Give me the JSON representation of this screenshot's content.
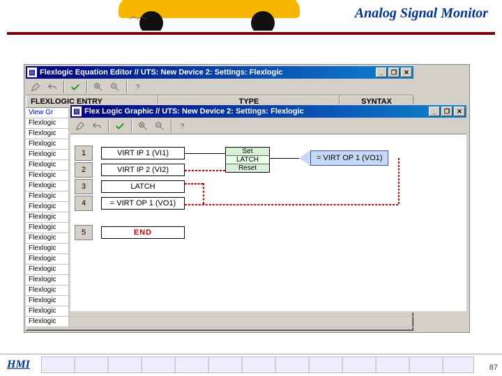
{
  "page": {
    "title": "Analog Signal Monitor",
    "footer_label": "HMI",
    "page_number": "87"
  },
  "editor_window": {
    "title": "Flexlogic Equation Editor // UTS: New Device 2: Settings: Flexlogic",
    "btn_min": "_",
    "btn_max": "❐",
    "btn_close": "✕",
    "columns": {
      "entry": "FLEXLOGIC ENTRY",
      "type": "TYPE",
      "syntax": "SYNTAX"
    },
    "first_row_label": "View Gr",
    "stub_label": "Flexlogic"
  },
  "graphic_window": {
    "title": "Flex Logic Graphic // UTS: New Device 2: Settings: Flexlogic",
    "btn_min": "_",
    "btn_max": "❐",
    "btn_close": "✕",
    "rows": {
      "r1": "1",
      "r2": "2",
      "r3": "3",
      "r4": "4",
      "r5": "5"
    },
    "blocks": {
      "b1": "VIRT IP 1 (VI1)",
      "b2": "VIRT IP 2 (VI2)",
      "b3": "LATCH",
      "b4": "= VIRT OP 1 (VO1)",
      "b5": "END"
    },
    "latch": {
      "set": "Set",
      "name": "LATCH",
      "reset": "Reset"
    },
    "output": "= VIRT OP 1 (VO1)"
  }
}
